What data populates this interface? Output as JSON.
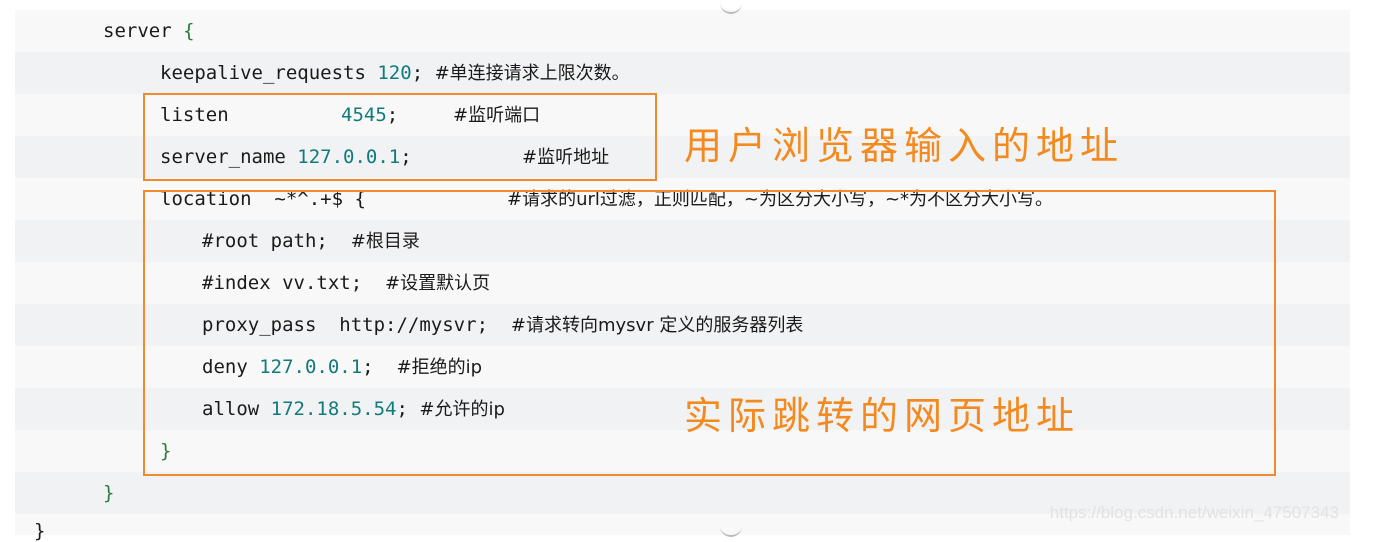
{
  "code": {
    "server_open": {
      "keyword": "server",
      "brace": "{"
    },
    "keepalive": {
      "directive": "keepalive_requests",
      "value": "120",
      "semi": ";",
      "comment": "#单连接请求上限次数。"
    },
    "listen": {
      "directive": "listen",
      "value": "4545",
      "semi": ";",
      "comment": "#监听端口"
    },
    "server_name": {
      "directive": "server_name",
      "value": "127.0.0.1",
      "semi": ";",
      "comment": "#监听地址"
    },
    "location": {
      "text": "location  ~*^.+$ {",
      "comment": "#请求的url过滤，正则匹配，~为区分大小写，~*为不区分大小写。"
    },
    "root": {
      "text": "#root path;",
      "comment": "#根目录"
    },
    "index": {
      "text": "#index vv.txt;",
      "comment": "#设置默认页"
    },
    "proxy_pass": {
      "directive": "proxy_pass",
      "value": "http://mysvr",
      "semi": ";",
      "comment": "#请求转向mysvr 定义的服务器列表"
    },
    "deny": {
      "directive": "deny",
      "value": "127.0.0.1",
      "semi": ";",
      "comment": "#拒绝的ip"
    },
    "allow": {
      "directive": "allow",
      "value": "172.18.5.54",
      "semi": ";",
      "comment": "#允许的ip"
    },
    "location_close": "}",
    "server_close": "}",
    "outer_close": "}"
  },
  "annotations": {
    "browser_address": "用户浏览器输入的地址",
    "redirect_address": "实际跳转的网页地址"
  },
  "colors": {
    "highlight_border": "#f08a2c",
    "annotation_text": "#f38a1f",
    "number": "#127a7a"
  },
  "watermark": "https://blog.csdn.net/weixin_47507343"
}
